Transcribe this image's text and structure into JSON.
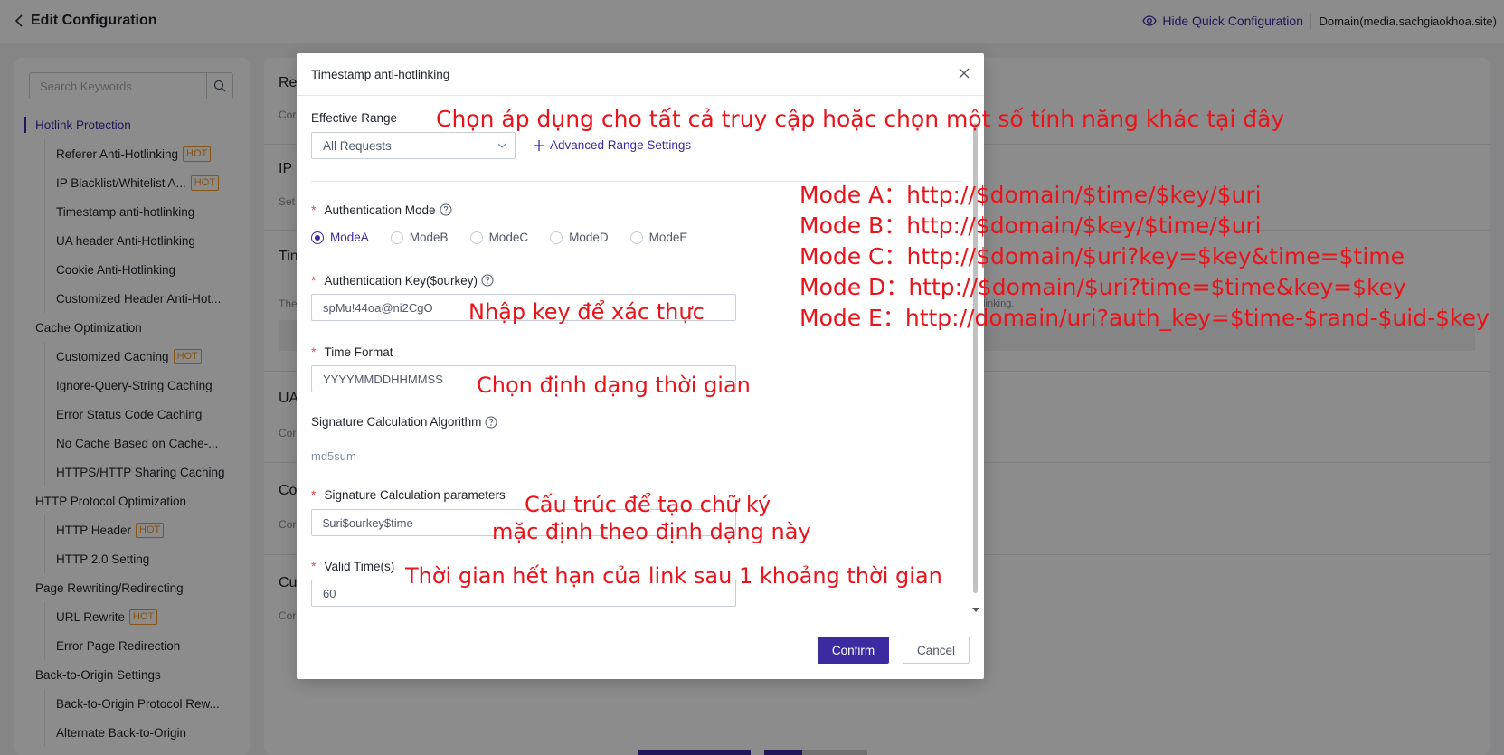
{
  "header": {
    "title": "Edit Configuration",
    "quick_config": "Hide Quick Configuration",
    "domain": "Domain(media.sachgiaokhoa.site)"
  },
  "sidebar": {
    "search_placeholder": "Search Keywords",
    "items": [
      {
        "label": "Hotlink Protection",
        "level": "group",
        "active": true,
        "hot": ""
      },
      {
        "label": "Referer Anti-Hotlinking",
        "level": "sub",
        "hot": "HOT"
      },
      {
        "label": "IP Blacklist/Whitelist A...",
        "level": "sub",
        "hot": "HOT"
      },
      {
        "label": "Timestamp anti-hotlinking",
        "level": "sub",
        "hot": ""
      },
      {
        "label": "UA header Anti-Hotlinking",
        "level": "sub",
        "hot": ""
      },
      {
        "label": "Cookie Anti-Hotlinking",
        "level": "sub",
        "hot": ""
      },
      {
        "label": "Customized Header Anti-Hot...",
        "level": "sub",
        "hot": ""
      },
      {
        "label": "Cache Optimization",
        "level": "group",
        "hot": ""
      },
      {
        "label": "Customized Caching",
        "level": "sub",
        "hot": "HOT"
      },
      {
        "label": "Ignore-Query-String Caching",
        "level": "sub",
        "hot": ""
      },
      {
        "label": "Error Status Code Caching",
        "level": "sub",
        "hot": ""
      },
      {
        "label": "No Cache Based on Cache-...",
        "level": "sub",
        "hot": ""
      },
      {
        "label": "HTTPS/HTTP Sharing Caching",
        "level": "sub",
        "hot": ""
      },
      {
        "label": "HTTP Protocol Optimization",
        "level": "group",
        "hot": ""
      },
      {
        "label": "HTTP Header",
        "level": "sub",
        "hot": "HOT"
      },
      {
        "label": "HTTP 2.0 Setting",
        "level": "sub",
        "hot": ""
      },
      {
        "label": "Page Rewriting/Redirecting",
        "level": "group",
        "hot": ""
      },
      {
        "label": "URL Rewrite",
        "level": "sub",
        "hot": "HOT"
      },
      {
        "label": "Error Page Redirection",
        "level": "sub",
        "hot": ""
      },
      {
        "label": "Back-to-Origin Settings",
        "level": "group",
        "hot": ""
      },
      {
        "label": "Back-to-Origin Protocol Rew...",
        "level": "sub",
        "hot": ""
      },
      {
        "label": "Alternate Back-to-Origin",
        "level": "sub",
        "hot": ""
      }
    ]
  },
  "main": {
    "sections": [
      {
        "title": "Re",
        "desc": "Cor"
      },
      {
        "title": "IP",
        "desc": "Set"
      },
      {
        "title": "Tin",
        "desc": "The"
      },
      {
        "title": "UA",
        "desc": "Cor"
      },
      {
        "title": "Co",
        "desc": "Cor"
      },
      {
        "title": "Cu",
        "desc": "Cor"
      }
    ],
    "hint_fragment": "otlinking."
  },
  "dialog": {
    "title": "Timestamp anti-hotlinking",
    "effective_range_label": "Effective Range",
    "effective_range_value": "All Requests",
    "advanced_range": "Advanced Range Settings",
    "auth_mode_label": "Authentication Mode",
    "modes": [
      "ModeA",
      "ModeB",
      "ModeC",
      "ModeD",
      "ModeE"
    ],
    "selected_mode": "ModeA",
    "auth_key_label": "Authentication Key($ourkey)",
    "auth_key_value": "spMu!44oa@ni2CgO",
    "time_format_label": "Time Format",
    "time_format_value": "YYYYMMDDHHMMSS",
    "sig_algo_label": "Signature Calculation Algorithm",
    "sig_algo_value": "md5sum",
    "sig_params_label": "Signature Calculation parameters",
    "sig_params_value": "$uri$ourkey$time",
    "valid_time_label": "Valid Time(s)",
    "valid_time_value": "60",
    "confirm": "Confirm",
    "cancel": "Cancel"
  },
  "annotations": {
    "range_note": "Chọn áp dụng cho tất cả truy cập hoặc chọn một số tính năng khác tại đây",
    "mode_a": "Mode A：http://$domain/$time/$key/$uri",
    "mode_b": "Mode B：http://$domain/$key/$time/$uri",
    "mode_c": "Mode C：http://$domain/$uri?key=$key&time=$time",
    "mode_d": "Mode D：http://$domain/$uri?time=$time&key=$key",
    "mode_e": "Mode E：http://domain/uri?auth_key=$time-$rand-$uid-$key",
    "key_note": "Nhập key để xác thực",
    "time_note": "Chọn định dạng thời gian",
    "sig_note_1": "Cấu trúc để tạo chữ ký",
    "sig_note_2": "mặc định theo định dạng này",
    "valid_note": "Thời gian hết hạn của link sau 1 khoảng thời gian"
  },
  "colors": {
    "accent": "#3b2ba0",
    "annotation": "#e8141b",
    "hot_badge": "#f59a23",
    "required": "#e5484d"
  }
}
